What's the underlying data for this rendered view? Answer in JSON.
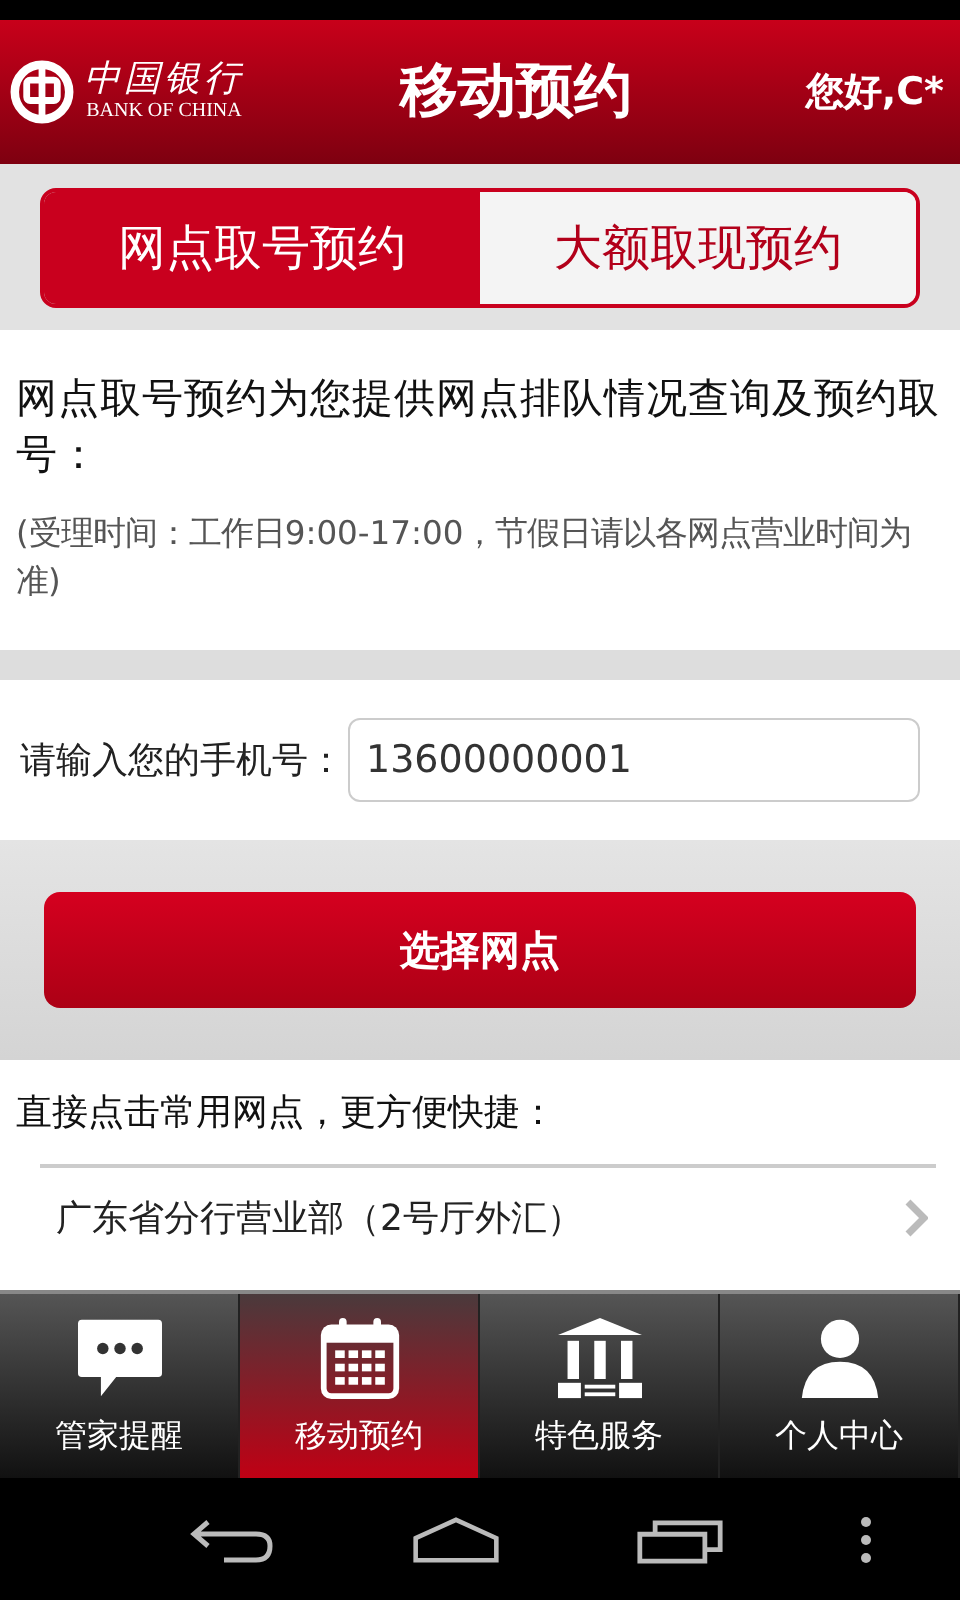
{
  "header": {
    "logo_name": "中国银行",
    "logo_subtitle": "BANK OF CHINA",
    "title": "移动预约",
    "greeting": "您好,C*"
  },
  "tabs": [
    {
      "label": "网点取号预约",
      "selected": true
    },
    {
      "label": "大额取现预约",
      "selected": false
    }
  ],
  "intro": {
    "text": "网点取号预约为您提供网点排队情况查询及预约取号：",
    "note": "(受理时间：工作日9:00-17:00，节假日请以各网点营业时间为准)"
  },
  "phone": {
    "label": "请输入您的手机号：",
    "value": "13600000001"
  },
  "select_button": "选择网点",
  "favorites": {
    "heading": "直接点击常用网点，更方便快捷：",
    "items": [
      {
        "label": "广东省分行营业部（2号厅外汇）"
      }
    ]
  },
  "bottom_nav": [
    {
      "label": "管家提醒",
      "selected": false
    },
    {
      "label": "移动预约",
      "selected": true
    },
    {
      "label": "特色服务",
      "selected": false
    },
    {
      "label": "个人中心",
      "selected": false
    }
  ]
}
